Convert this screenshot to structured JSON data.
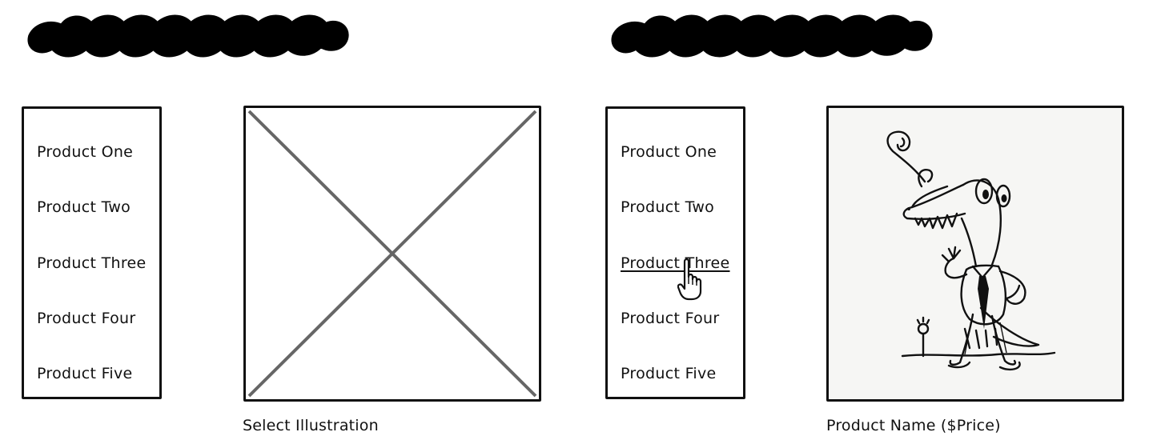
{
  "left_screen": {
    "product_list": [
      "Product One",
      "Product Two",
      "Product Three",
      "Product Four",
      "Product Five"
    ],
    "image_state": "placeholder",
    "caption": "Select Illustration"
  },
  "right_screen": {
    "product_list": [
      "Product One",
      "Product Two",
      "Product Three",
      "Product Four",
      "Product Five"
    ],
    "hovered_item": "Product Three",
    "image_state": "product-illustration",
    "caption": "Product Name ($Price)"
  },
  "colors": {
    "ink": "#111111",
    "placeholder_cross": "#666666",
    "background": "#ffffff"
  },
  "icons": {
    "title_scribble": "scribble-title-icon",
    "cursor": "pointer-hand-icon",
    "illustration": "crocodile-character-illustration"
  }
}
